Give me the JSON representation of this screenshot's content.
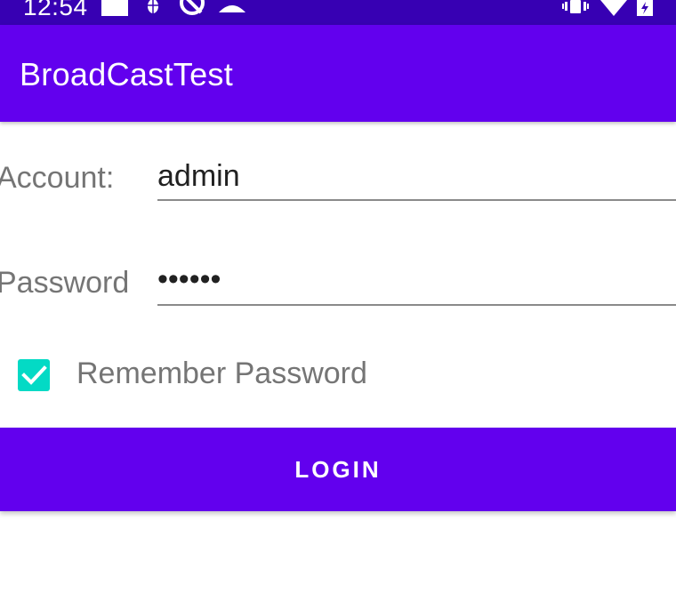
{
  "status_bar": {
    "time": "12:54",
    "icons": [
      "sd-card-icon",
      "bug-icon",
      "no-data-saver-icon",
      "account-icon",
      "vibrate-icon",
      "wifi-icon",
      "battery-charging-icon"
    ]
  },
  "app_bar": {
    "title": "BroadCastTest"
  },
  "form": {
    "account_label": "Account:",
    "account_value": "admin",
    "password_label": "Password",
    "password_value": "••••••",
    "remember": {
      "label": "Remember Password",
      "checked": true
    },
    "login_label": "LOGIN"
  },
  "colors": {
    "status_bar": "#3700b3",
    "primary": "#6200ee",
    "accent": "#03dac5",
    "label_text": "#757575",
    "input_text": "#212121"
  }
}
